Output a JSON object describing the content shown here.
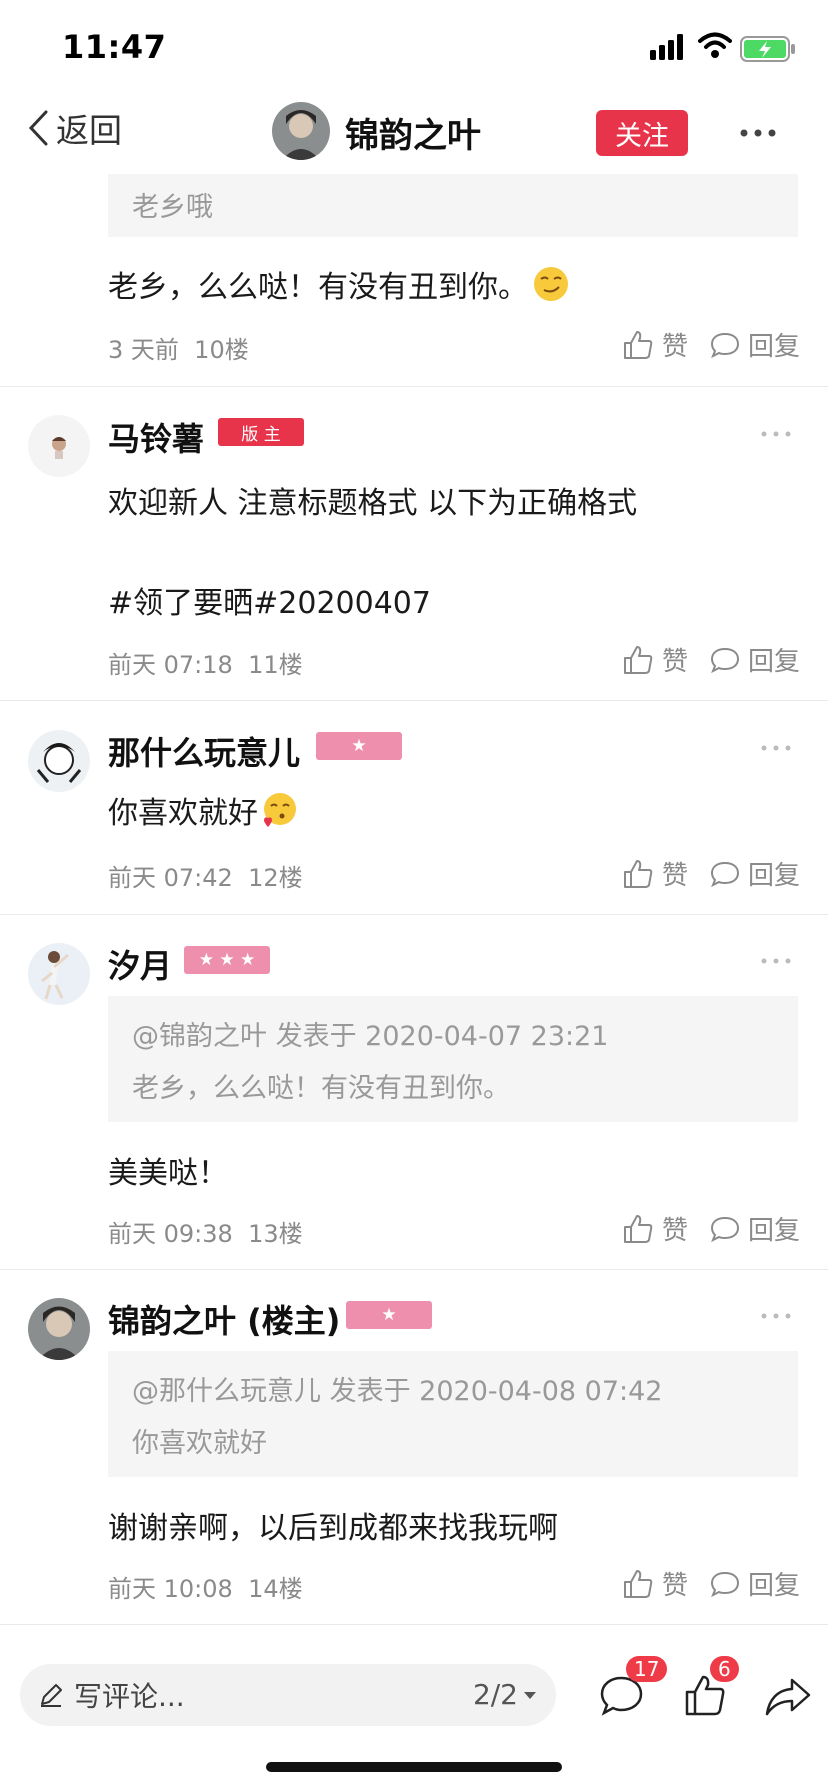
{
  "status": {
    "time": "11:47"
  },
  "nav": {
    "back_label": "返回",
    "title": "锦韵之叶",
    "follow_label": "关注"
  },
  "top_comment": {
    "quote": "老乡哦",
    "text": "老乡，么么哒！有没有丑到你。",
    "time": "3 天前",
    "floor": "10楼"
  },
  "actions": {
    "like_label": "赞",
    "reply_label": "回复"
  },
  "comments": [
    {
      "name": "马铃薯",
      "badge": "版 主",
      "text_line1": "欢迎新人 注意标题格式 以下为正确格式",
      "text_line2": "#领了要晒#20200407",
      "time": "前天 07:18",
      "floor": "11楼"
    },
    {
      "name": "那什么玩意儿",
      "badge": "★",
      "text": "你喜欢就好",
      "time": "前天 07:42",
      "floor": "12楼"
    },
    {
      "name": "汐月",
      "badge": "★ ★ ★",
      "quote_head": "@锦韵之叶 发表于 2020-04-07 23:21",
      "quote_text": "老乡，么么哒！有没有丑到你。",
      "text": "美美哒！",
      "time": "前天 09:38",
      "floor": "13楼"
    },
    {
      "name": "锦韵之叶 (楼主)",
      "badge": "★",
      "quote_head": "@那什么玩意儿 发表于 2020-04-08 07:42",
      "quote_text": "你喜欢就好",
      "text": "谢谢亲啊，以后到成都来找我玩啊",
      "time": "前天 10:08",
      "floor": "14楼"
    }
  ],
  "bottom": {
    "placeholder": "写评论...",
    "page": "2/2",
    "comment_count": "17",
    "like_count": "6"
  },
  "colors": {
    "accent": "#e8344b",
    "badge_pink": "#ef8fae",
    "meta_gray": "#8a8a8a"
  }
}
